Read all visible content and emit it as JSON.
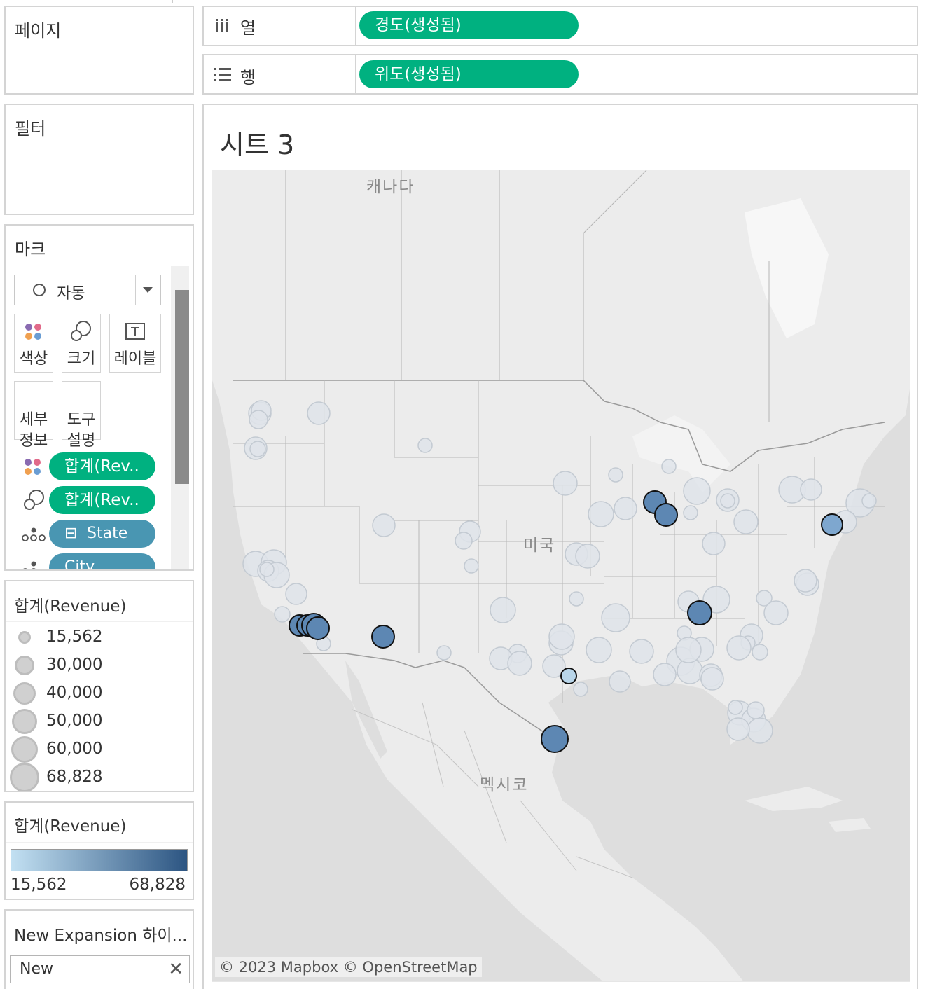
{
  "pages": {
    "title": "페이지"
  },
  "filters": {
    "title": "필터"
  },
  "shelves": {
    "columns": {
      "label": "열",
      "pill": "경도(생성됨)"
    },
    "rows": {
      "label": "행",
      "pill": "위도(생성됨)"
    }
  },
  "marks": {
    "title": "마크",
    "mark_type": "자동",
    "buttons": {
      "color": "색상",
      "size": "크기",
      "label": "레이블",
      "detail": "세부\n정보",
      "tooltip": "도구\n설명"
    },
    "pills": [
      {
        "icon": "color-dots-icon",
        "label": "합계(Rev.."
      },
      {
        "icon": "size-icon",
        "label": "합계(Rev.."
      },
      {
        "icon": "detail-icon",
        "label": "State",
        "prefix": "⊟"
      },
      {
        "icon": "detail-icon",
        "label": "City"
      }
    ]
  },
  "size_legend": {
    "title": "합계(Revenue)",
    "items": [
      "15,562",
      "30,000",
      "40,000",
      "50,000",
      "60,000",
      "68,828"
    ]
  },
  "color_legend": {
    "title": "합계(Revenue)",
    "min": "15,562",
    "max": "68,828",
    "colors": {
      "low": "#c2e0f2",
      "high": "#2c5582"
    }
  },
  "filter_card": {
    "title": "New Expansion 하이...",
    "value": "New"
  },
  "sheet": {
    "title": "시트 3",
    "map_labels": {
      "canada": "캐나다",
      "usa": "미국",
      "mexico": "멕시코"
    },
    "attribution": "© 2023 Mapbox © OpenStreetMap"
  },
  "colors": {
    "green_pill": "#00b180",
    "blue_pill": "#4996b2",
    "highlight_mark": "#5d87b3",
    "dim_mark": "#dfe4ea"
  }
}
